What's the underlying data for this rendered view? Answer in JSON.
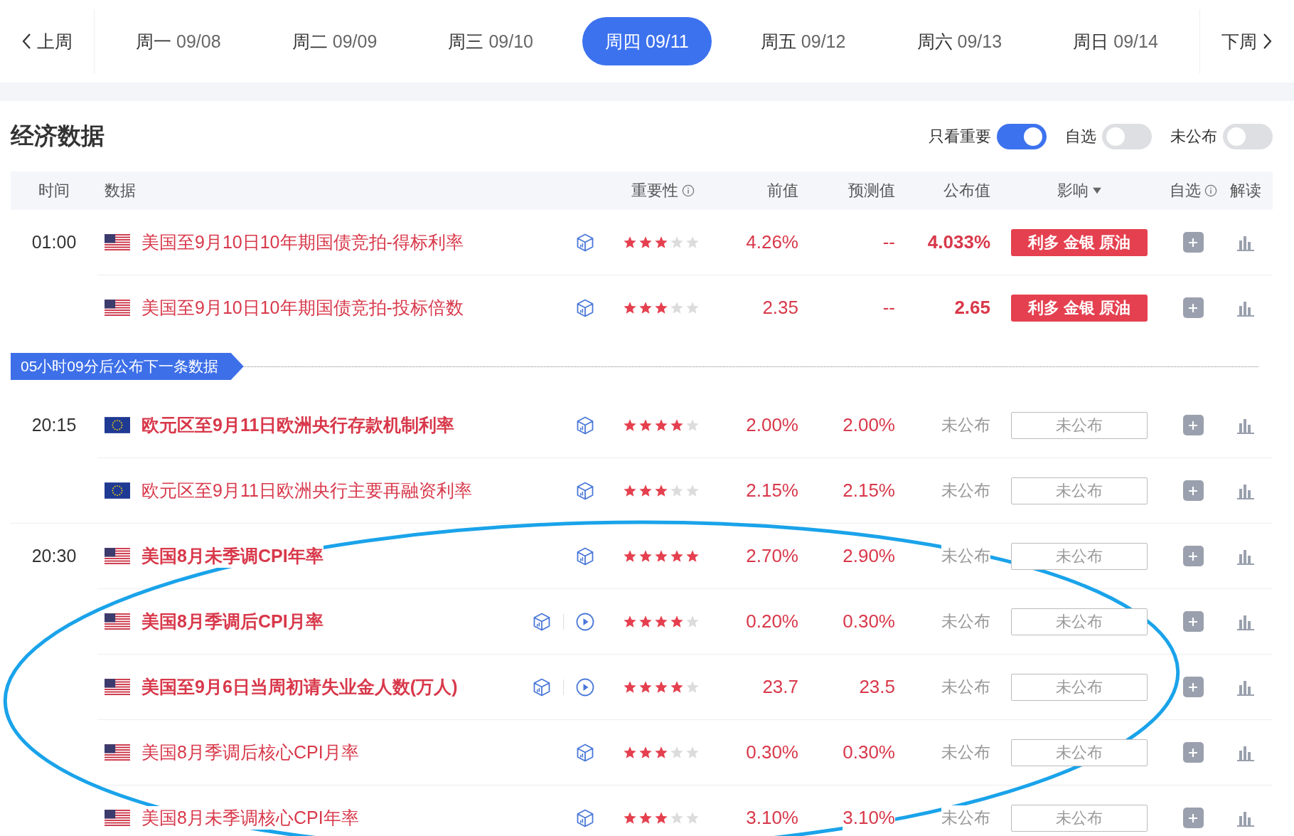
{
  "nav": {
    "prev": "上周",
    "next": "下周",
    "days": [
      {
        "day": "周一",
        "date": "09/08",
        "selected": false
      },
      {
        "day": "周二",
        "date": "09/09",
        "selected": false
      },
      {
        "day": "周三",
        "date": "09/10",
        "selected": false
      },
      {
        "day": "周四",
        "date": "09/11",
        "selected": true
      },
      {
        "day": "周五",
        "date": "09/12",
        "selected": false
      },
      {
        "day": "周六",
        "date": "09/13",
        "selected": false
      },
      {
        "day": "周日",
        "date": "09/14",
        "selected": false
      }
    ]
  },
  "section": {
    "title": "经济数据",
    "filters": [
      {
        "label": "只看重要",
        "on": true
      },
      {
        "label": "自选",
        "on": false
      },
      {
        "label": "未公布",
        "on": false
      }
    ]
  },
  "table": {
    "columns": [
      {
        "label": "时间",
        "kind": "plain"
      },
      {
        "label": "数据",
        "kind": "plain"
      },
      {
        "label": "重要性",
        "kind": "info"
      },
      {
        "label": "前值",
        "kind": "plain"
      },
      {
        "label": "预测值",
        "kind": "plain"
      },
      {
        "label": "公布值",
        "kind": "plain"
      },
      {
        "label": "影响",
        "kind": "sort"
      },
      {
        "label": "自选",
        "kind": "info"
      },
      {
        "label": "解读",
        "kind": "plain"
      }
    ],
    "timeline": [
      {
        "kind": "group",
        "time": "01:00",
        "events": [
          {
            "flag": {
              "kind": "us"
            },
            "name": "美国至9月10日10年期国债竞拍-得标利率",
            "bold": false,
            "icons": [
              {
                "kind": "cube"
              }
            ],
            "stars": 3,
            "previous": "4.26%",
            "forecast": "--",
            "actual": "4.033%",
            "published": true,
            "impact": {
              "kind": "tag",
              "text": "利多 金银 原油"
            }
          },
          {
            "flag": {
              "kind": "us"
            },
            "name": "美国至9月10日10年期国债竞拍-投标倍数",
            "bold": false,
            "icons": [
              {
                "kind": "cube"
              }
            ],
            "stars": 3,
            "previous": "2.35",
            "forecast": "--",
            "actual": "2.65",
            "published": true,
            "impact": {
              "kind": "tag",
              "text": "利多 金银 原油"
            }
          }
        ]
      },
      {
        "kind": "banner",
        "text": "05小时09分后公布下一条数据"
      },
      {
        "kind": "group",
        "time": "20:15",
        "events": [
          {
            "flag": {
              "kind": "eu"
            },
            "name": "欧元区至9月11日欧洲央行存款机制利率",
            "bold": true,
            "icons": [
              {
                "kind": "cube"
              }
            ],
            "stars": 4,
            "previous": "2.00%",
            "forecast": "2.00%",
            "actual": "未公布",
            "published": false,
            "impact": {
              "kind": "pending",
              "text": "未公布"
            }
          },
          {
            "flag": {
              "kind": "eu"
            },
            "name": "欧元区至9月11日欧洲央行主要再融资利率",
            "bold": false,
            "icons": [
              {
                "kind": "cube"
              }
            ],
            "stars": 3,
            "previous": "2.15%",
            "forecast": "2.15%",
            "actual": "未公布",
            "published": false,
            "impact": {
              "kind": "pending",
              "text": "未公布"
            }
          }
        ]
      },
      {
        "kind": "group",
        "time": "20:30",
        "events": [
          {
            "flag": {
              "kind": "us"
            },
            "name": "美国8月未季调CPI年率",
            "bold": true,
            "icons": [
              {
                "kind": "cube"
              }
            ],
            "stars": 5,
            "previous": "2.70%",
            "forecast": "2.90%",
            "actual": "未公布",
            "published": false,
            "impact": {
              "kind": "pending",
              "text": "未公布"
            }
          },
          {
            "flag": {
              "kind": "us"
            },
            "name": "美国8月季调后CPI月率",
            "bold": true,
            "icons": [
              {
                "kind": "cube"
              },
              {
                "kind": "play"
              }
            ],
            "stars": 4,
            "previous": "0.20%",
            "forecast": "0.30%",
            "actual": "未公布",
            "published": false,
            "impact": {
              "kind": "pending",
              "text": "未公布"
            }
          },
          {
            "flag": {
              "kind": "us"
            },
            "name": "美国至9月6日当周初请失业金人数(万人)",
            "bold": true,
            "icons": [
              {
                "kind": "cube"
              },
              {
                "kind": "play"
              }
            ],
            "stars": 4,
            "previous": "23.7",
            "forecast": "23.5",
            "actual": "未公布",
            "published": false,
            "impact": {
              "kind": "pending",
              "text": "未公布"
            }
          },
          {
            "flag": {
              "kind": "us"
            },
            "name": "美国8月季调后核心CPI月率",
            "bold": false,
            "icons": [
              {
                "kind": "cube"
              }
            ],
            "stars": 3,
            "previous": "0.30%",
            "forecast": "0.30%",
            "actual": "未公布",
            "published": false,
            "impact": {
              "kind": "pending",
              "text": "未公布"
            }
          },
          {
            "flag": {
              "kind": "us"
            },
            "name": "美国8月未季调核心CPI年率",
            "bold": false,
            "icons": [
              {
                "kind": "cube"
              }
            ],
            "stars": 3,
            "previous": "3.10%",
            "forecast": "3.10%",
            "actual": "未公布",
            "published": false,
            "impact": {
              "kind": "pending",
              "text": "未公布"
            }
          }
        ]
      }
    ]
  },
  "annotation": {
    "kind": "ellipse"
  }
}
